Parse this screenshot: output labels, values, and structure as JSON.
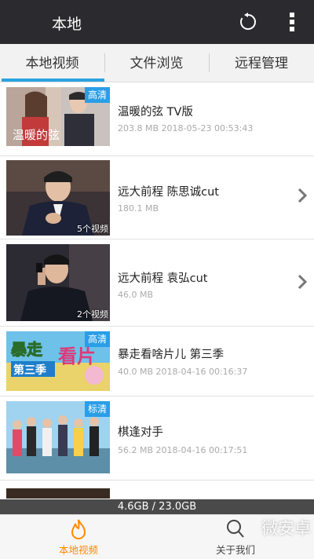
{
  "header": {
    "title": "本地"
  },
  "tabs": [
    {
      "label": "本地视频",
      "active": true
    },
    {
      "label": "文件浏览",
      "active": false
    },
    {
      "label": "远程管理",
      "active": false
    }
  ],
  "colors": {
    "header_bg": "#2b2b2f",
    "accent": "#2aa3e0",
    "hd_badge": "#2a9ee6",
    "nav_active": "#ff8a00",
    "storage_bar": "#4a4a4a"
  },
  "videos": [
    {
      "title": "温暖的弦 TV版",
      "meta": "203.8 MB  2018-05-23 00:53:43",
      "badge": "高清",
      "poster_text": "温暖的弦"
    },
    {
      "title": "远大前程 陈思诚cut",
      "meta": "180.1 MB",
      "count": "5个视频"
    },
    {
      "title": "远大前程 袁弘cut",
      "meta": "46.0 MB",
      "count": "2个视频"
    },
    {
      "title": "暴走看啥片儿 第三季",
      "meta": "40.0 MB  2018-04-16 00:16:37",
      "badge": "高清",
      "poster_text": "暴走看片儿第三季"
    },
    {
      "title": "棋逢对手",
      "meta": "56.2 MB  2018-04-16 00:17:51",
      "badge": "标清"
    }
  ],
  "storage": {
    "text": "4.6GB / 23.0GB"
  },
  "bottom_nav": [
    {
      "label": "本地视频",
      "icon": "flame-icon",
      "active": true
    },
    {
      "label": "关于我们",
      "icon": "search-icon",
      "active": false
    }
  ],
  "watermark": {
    "text": "微安卓"
  }
}
